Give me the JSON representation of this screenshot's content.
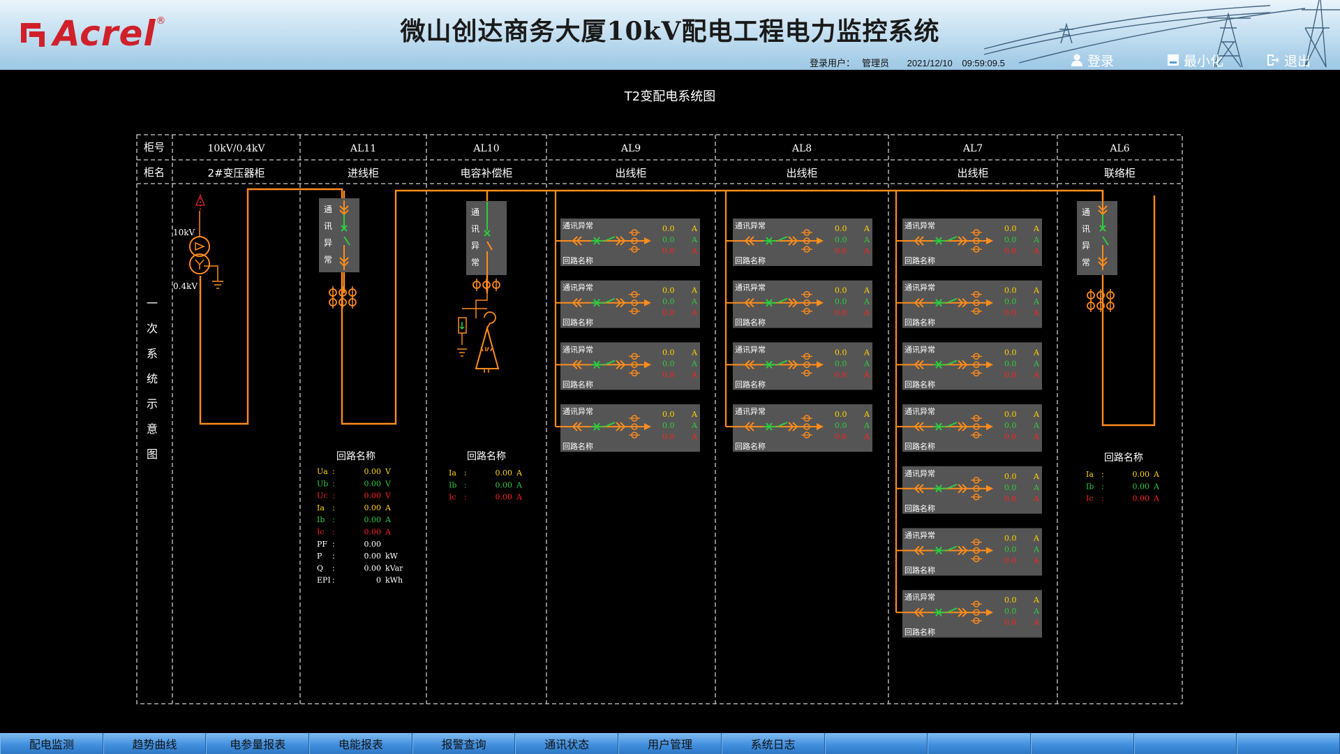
{
  "header": {
    "logo_text": "Acrel",
    "logo_reg": "®",
    "title": "微山创达商务大厦10kV配电工程电力监控系统",
    "login_label": "登录用户：",
    "login_user": "管理员",
    "date": "2021/12/10",
    "time": "09:59:09.5",
    "buttons": {
      "login": "登录",
      "minimize": "最小化",
      "exit": "退出"
    }
  },
  "diagram": {
    "title": "T2变配电系统图",
    "row_label_number": "柜号",
    "row_label_name": "柜名",
    "side_label": [
      "一",
      "次",
      "系",
      "统",
      "示",
      "意",
      "图"
    ],
    "columns": [
      {
        "number": "10kV/0.4kV",
        "name": "2#变压器柜"
      },
      {
        "number": "AL11",
        "name": "进线柜"
      },
      {
        "number": "AL10",
        "name": "电容补偿柜"
      },
      {
        "number": "AL9",
        "name": "出线柜"
      },
      {
        "number": "AL8",
        "name": "出线柜"
      },
      {
        "number": "AL7",
        "name": "出线柜"
      },
      {
        "number": "AL6",
        "name": "联络柜"
      }
    ],
    "transformer": {
      "hv": "10kV",
      "lv": "0.4kV"
    },
    "comm_vertical": [
      "通",
      "讯",
      "异",
      "常"
    ],
    "feeder": {
      "comm": "通讯异常",
      "circuit": "回路名称",
      "values": [
        "0.0",
        "0.0",
        "0.0"
      ],
      "unit": "A"
    },
    "feeder_counts": {
      "al9": 4,
      "al8": 4,
      "al7": 7
    },
    "al11_readings": {
      "title": "回路名称",
      "rows": [
        {
          "label": "Ua",
          "value": "0.00",
          "unit": "V",
          "color": "#ffd400"
        },
        {
          "label": "Ub",
          "value": "0.00",
          "unit": "V",
          "color": "#2ecc40"
        },
        {
          "label": "Uc",
          "value": "0.00",
          "unit": "V",
          "color": "#ff2020"
        },
        {
          "label": "Ia",
          "value": "0.00",
          "unit": "A",
          "color": "#ffd400"
        },
        {
          "label": "Ib",
          "value": "0.00",
          "unit": "A",
          "color": "#2ecc40"
        },
        {
          "label": "Ic",
          "value": "0.00",
          "unit": "A",
          "color": "#ff2020"
        },
        {
          "label": "PF",
          "value": "0.00",
          "unit": "",
          "color": "#ffffff"
        },
        {
          "label": "P",
          "value": "0.00",
          "unit": "kW",
          "color": "#ffffff"
        },
        {
          "label": "Q",
          "value": "0.00",
          "unit": "kVar",
          "color": "#ffffff"
        },
        {
          "label": "EPI",
          "value": "0",
          "unit": "kWh",
          "color": "#ffffff"
        }
      ]
    },
    "al10_readings": {
      "title": "回路名称",
      "rows": [
        {
          "label": "Ia",
          "value": "0.00",
          "unit": "A",
          "color": "#ffd400"
        },
        {
          "label": "Ib",
          "value": "0.00",
          "unit": "A",
          "color": "#2ecc40"
        },
        {
          "label": "Ic",
          "value": "0.00",
          "unit": "A",
          "color": "#ff2020"
        }
      ]
    },
    "al6_readings": {
      "title": "回路名称",
      "rows": [
        {
          "label": "Ia",
          "value": "0.00",
          "unit": "A",
          "color": "#ffd400"
        },
        {
          "label": "Ib",
          "value": "0.00",
          "unit": "A",
          "color": "#2ecc40"
        },
        {
          "label": "Ic",
          "value": "0.00",
          "unit": "A",
          "color": "#ff2020"
        }
      ]
    }
  },
  "nav": {
    "tabs": [
      "配电监测",
      "趋势曲线",
      "电参量报表",
      "电能报表",
      "报警查询",
      "通讯状态",
      "用户管理",
      "系统日志"
    ]
  },
  "colors": {
    "bus": "#ff8c1a",
    "closed": "#2ecc40",
    "box": "#555555"
  }
}
